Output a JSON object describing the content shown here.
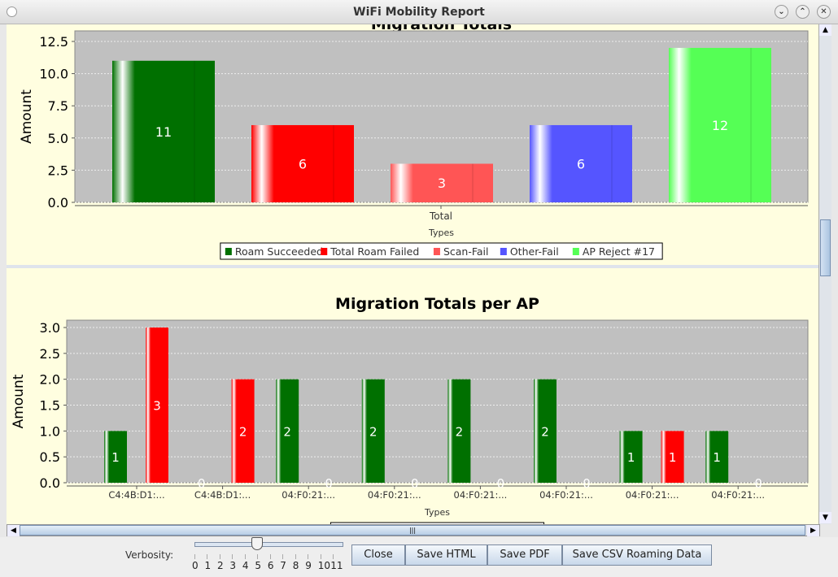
{
  "window": {
    "title": "WiFi Mobility Report"
  },
  "chart_data": [
    {
      "type": "bar",
      "title": "Migration Totals",
      "xlabel": "Types",
      "ylabel": "Amount",
      "ylim": [
        0,
        12.5
      ],
      "yticks": [
        "0.0",
        "2.5",
        "5.0",
        "7.5",
        "10.0",
        "12.5"
      ],
      "categories": [
        "Total"
      ],
      "grid": true,
      "legend": "bottom",
      "series": [
        {
          "name": "Roam Succeeded",
          "values": [
            11
          ],
          "color": "#007000"
        },
        {
          "name": "Total Roam Failed",
          "values": [
            6
          ],
          "color": "#ff0000"
        },
        {
          "name": "Scan-Fail",
          "values": [
            3
          ],
          "color": "#ff5555"
        },
        {
          "name": "Other-Fail",
          "values": [
            6
          ],
          "color": "#5555ff"
        },
        {
          "name": "AP Reject #17",
          "values": [
            12
          ],
          "color": "#55ff55"
        }
      ]
    },
    {
      "type": "bar",
      "title": "Migration Totals per AP",
      "xlabel": "Types",
      "ylabel": "Amount",
      "ylim": [
        0,
        3.0
      ],
      "yticks": [
        "0.0",
        "0.5",
        "1.0",
        "1.5",
        "2.0",
        "2.5",
        "3.0"
      ],
      "grid": true,
      "legend": "bottom",
      "categories": [
        "C4:4B:D1:...",
        "C4:4B:D1:...",
        "04:F0:21:...",
        "04:F0:21:...",
        "04:F0:21:...",
        "04:F0:21:...",
        "04:F0:21:...",
        "04:F0:21:..."
      ],
      "series": [
        {
          "name": "Roam Succeeded",
          "values": [
            1,
            0,
            2,
            2,
            2,
            2,
            1,
            1
          ],
          "color": "#007000"
        },
        {
          "name": "Total Roam Failed",
          "values": [
            3,
            2,
            0,
            0,
            0,
            0,
            1,
            0
          ],
          "color": "#ff0000"
        }
      ]
    }
  ],
  "controls": {
    "verbosity_label": "Verbosity:",
    "verbosity_value": 5,
    "verbosity_ticks": [
      "0",
      "1",
      "2",
      "3",
      "4",
      "5",
      "6",
      "7",
      "8",
      "9",
      "10",
      "11"
    ],
    "close": "Close",
    "save_html": "Save HTML",
    "save_pdf": "Save PDF",
    "save_csv": "Save CSV Roaming Data"
  }
}
